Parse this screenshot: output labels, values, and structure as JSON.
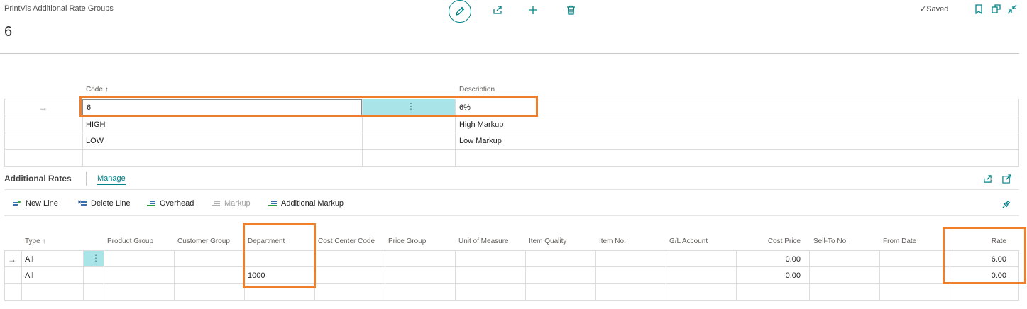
{
  "header": {
    "breadcrumb": "PrintVis Additional Rate Groups",
    "title": "6",
    "saved_label": "Saved",
    "icons": [
      "edit-icon",
      "share-icon",
      "add-icon",
      "delete-icon",
      "bookmark-icon",
      "open-new-window-icon",
      "collapse-icon"
    ]
  },
  "groups_table": {
    "columns": {
      "code": "Code ↑",
      "description": "Description"
    },
    "rows": [
      {
        "arrow": "→",
        "code": "6",
        "description": "6%"
      },
      {
        "arrow": "",
        "code": "HIGH",
        "description": "High Markup"
      },
      {
        "arrow": "",
        "code": "LOW",
        "description": "Low Markup"
      }
    ]
  },
  "additional_rates": {
    "title": "Additional Rates",
    "tab_manage": "Manage",
    "toolbar": {
      "new_line": "New Line",
      "delete_line": "Delete Line",
      "overhead": "Overhead",
      "markup": "Markup",
      "additional_markup": "Additional Markup"
    },
    "columns": {
      "type": "Type ↑",
      "product_group": "Product Group",
      "customer_group": "Customer Group",
      "department": "Department",
      "cost_center_code": "Cost Center Code",
      "price_group": "Price Group",
      "unit_of_measure": "Unit of Measure",
      "item_quality": "Item Quality",
      "item_no": "Item No.",
      "gl_account": "G/L Account",
      "cost_price": "Cost Price",
      "sell_to_no": "Sell-To No.",
      "from_date": "From Date",
      "rate": "Rate"
    },
    "rows": [
      {
        "arrow": "→",
        "type": "All",
        "department": "",
        "cost_price": "0.00",
        "rate": "6.00"
      },
      {
        "arrow": "",
        "type": "All",
        "department": "1000",
        "cost_price": "0.00",
        "rate": "0.00"
      }
    ]
  },
  "colors": {
    "accent": "#008489",
    "highlight": "#f07f2b",
    "selected_cell": "#a8e4e8"
  }
}
